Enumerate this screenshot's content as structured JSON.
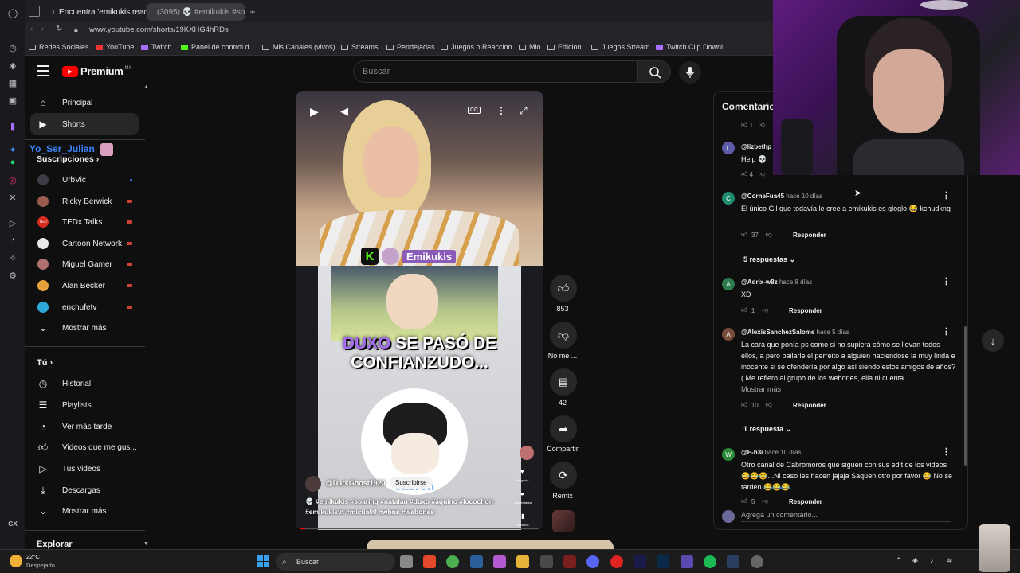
{
  "browser": {
    "tabs": [
      {
        "title": "Encuentra 'emikukis reaccio"
      },
      {
        "title": "(3095) 💀 #emikukis #so"
      }
    ],
    "url": "www.youtube.com/shorts/19KXHG4hRDs",
    "bookmarks": [
      "Redes Sociales",
      "YouTube",
      "Twitch",
      "Panel de control d...",
      "Mis Canales (vivos)",
      "Streams",
      "Pendejadas",
      "Juegos o Reaccion",
      "Mio",
      "Edicion",
      "Juegos Stream",
      "Twitch Clip Downl..."
    ],
    "rail_label": "GX"
  },
  "yt": {
    "logo_text": "Premium",
    "logo_region": "MX",
    "search_placeholder": "Buscar",
    "sidebar": {
      "top": [
        {
          "label": "Principal"
        },
        {
          "label": "Shorts"
        }
      ],
      "overlay_name": "Yo_Ser_Julian",
      "subs_title": "Suscripciones",
      "subs": [
        {
          "label": "UrbVic",
          "color": "#3d3d45"
        },
        {
          "label": "Ricky Berwick",
          "color": "#9a5c4c"
        },
        {
          "label": "TEDx Talks",
          "color": "#d62b1e"
        },
        {
          "label": "Cartoon Network",
          "color": "#e8e8e8"
        },
        {
          "label": "Miguel Gamer",
          "color": "#b07070"
        },
        {
          "label": "Alan Becker",
          "color": "#e6a23a"
        },
        {
          "label": "enchufetv",
          "color": "#2ea8d8"
        }
      ],
      "subs_more": "Mostrar más",
      "you_title": "Tú",
      "you": [
        {
          "label": "Historial"
        },
        {
          "label": "Playlists"
        },
        {
          "label": "Ver más tarde"
        },
        {
          "label": "Videos que me gus..."
        },
        {
          "label": "Tus videos"
        },
        {
          "label": "Descargas"
        }
      ],
      "you_more": "Mostrar más",
      "explore_title": "Explorar"
    },
    "video": {
      "stream_name": "Emikukis",
      "caption_line1": "DUXO",
      "caption_line1b": "SE PASÓ DE",
      "caption_line2": "CONFIANZUDO...",
      "sticker_text": "cabron",
      "channel": "@DarkGhost1920",
      "subscribe": "Suscribirse",
      "description": "💀 #emikukis #soaring #natalan #duxo #aquino #locochon #emikukisvt #mictia00 #wbns #webones",
      "mini_labels": [
        "Me gusta",
        "Comentarios",
        "Favoritos"
      ]
    },
    "actions": {
      "likes": "853",
      "dislike": "No me ...",
      "comments": "42",
      "share": "Compartir",
      "remix": "Remix"
    },
    "comments_panel": {
      "title": "Comentarios",
      "reply_label": "Responder",
      "items": [
        {
          "user": "@CorneFua45",
          "time": "hace 10 días",
          "text": "El único Gil que todavía le cree a emikukis es gloglo 😂 kchudkng",
          "likes": "37",
          "avatar": "C",
          "color": "#1e8c6e"
        },
        {
          "user": "@Adrix-w8z",
          "time": "hace 8 días",
          "text": "XD",
          "likes": "1",
          "avatar": "A",
          "color": "#2e7d4f"
        },
        {
          "user": "@AlexisSanchezSalome",
          "time": "hace 5 días",
          "text": "La cara que ponía ps como si no supiera cómo se llevan todos ellos, a pero bailarle el perreito a alguien haciendose la muy linda e inocente si se ofendería por algo así siendo estos amigos de años? ( Me refiero al grupo de los webones, ella ni cuenta ...",
          "likes": "10",
          "avatar": "A",
          "color": "#7a4a3a"
        },
        {
          "user": "@E-h3i",
          "time": "hace 10 días",
          "text": "Otro canal de Cabromoros que siguen con sus edit de los videos 😂😂😂...Ni caso les hacen jajaja Saquen otro por favor 😂 No se tarden 😂😂😂",
          "likes": "5",
          "avatar": "W",
          "color": "#2a8a3a"
        }
      ],
      "partial_top": {
        "user": "@lizbethp",
        "text": "Help 💀",
        "likes_prev": "1",
        "likes": "4"
      },
      "replies_1": "5 respuestas",
      "replies_2": "1 respuesta",
      "show_more": "Mostrar más",
      "add_comment": "Agrega un comentario..."
    }
  },
  "taskbar": {
    "weather_temp": "22°C",
    "weather_desc": "Despejado",
    "search": "Buscar"
  }
}
